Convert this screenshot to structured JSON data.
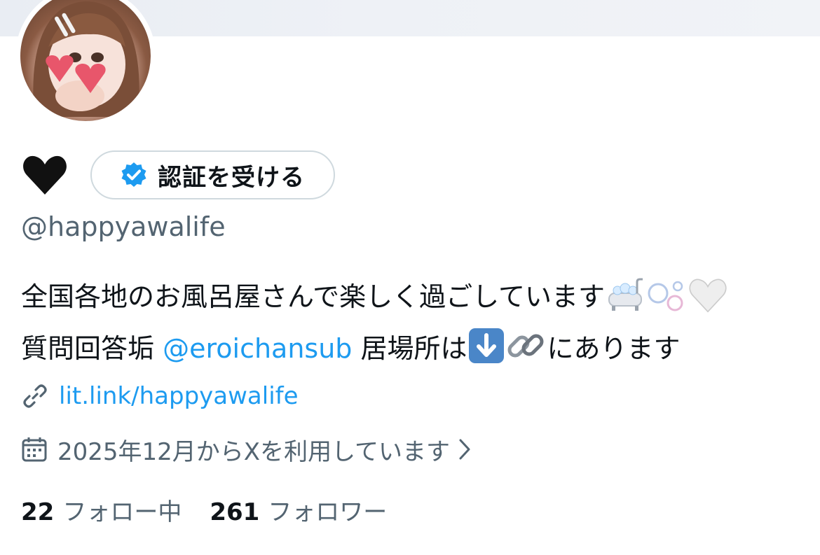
{
  "profile": {
    "display_name_icon": "black-heart-emoji",
    "verify_button_label": "認証を受ける",
    "handle": "@happyawalife",
    "bio": {
      "line1_text": "全国各地のお風呂屋さんで楽しく過ごしています",
      "line1_emojis": [
        "bathtub-emoji",
        "bubbles-emoji",
        "white-heart-emoji"
      ],
      "line2_prefix": "質問回答垢 ",
      "line2_mention": "@eroichansub",
      "line2_middle": " 居場所は",
      "line2_emojis": [
        "down-arrow-emoji",
        "link-emoji"
      ],
      "line2_suffix": "にあります"
    },
    "website": "lit.link/happyawalife",
    "joined": "2025年12月からXを利用しています",
    "following_count": "22",
    "following_label": "フォロー中",
    "followers_count": "261",
    "followers_label": "フォロワー"
  },
  "colors": {
    "link": "#1d9bf0",
    "secondary_text": "#536471",
    "border": "#cfd9de",
    "verified_badge": "#1d9bf0"
  }
}
